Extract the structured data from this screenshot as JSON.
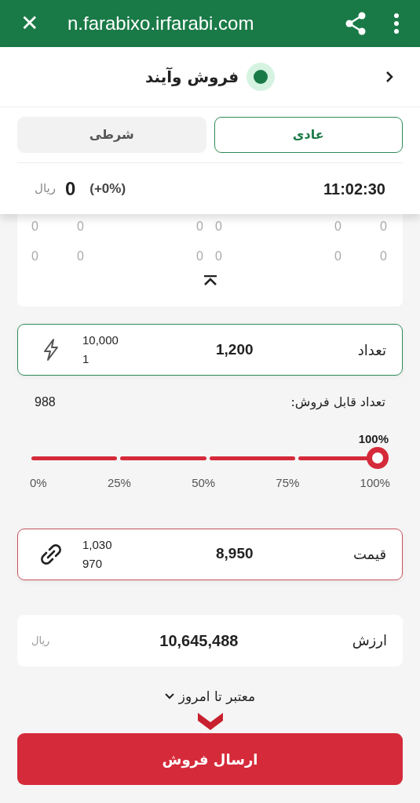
{
  "browser_bar": {
    "close": "✕",
    "url": "n.farabixo.irfarabi.com"
  },
  "header": {
    "title": "فروش وآیند"
  },
  "tabs": [
    {
      "label": "عادی",
      "selected": true
    },
    {
      "label": "شرطی",
      "selected": false
    }
  ],
  "quote": {
    "time": "11:02:30",
    "change": "(+0%)",
    "price": "0",
    "currency": "ریال"
  },
  "order_book": {
    "rows": [
      [
        "0",
        "0",
        "0",
        "0",
        "0",
        "0"
      ],
      [
        "0",
        "0",
        "0",
        "0",
        "0",
        "0"
      ]
    ]
  },
  "fields": [
    {
      "kind": "quantity",
      "label": "تعداد",
      "value": "1,200",
      "max": "10,000",
      "min": "1",
      "color": "#2e8b57"
    },
    {
      "kind": "price",
      "label": "قیمت",
      "value": "8,950",
      "max": "1,030",
      "min": "970",
      "color": "#c8505c"
    }
  ],
  "available": {
    "label": "تعداد قابل فروش:",
    "value": "988"
  },
  "slider": {
    "reading": "100%",
    "level": 1,
    "ticks": [
      "100%",
      "75%",
      "50%",
      "25%",
      "0%"
    ]
  },
  "value_card": {
    "label": "ارزش",
    "value": "10,645,488",
    "currency": "ریال"
  },
  "validity": {
    "label": "معتبر تا امروز"
  },
  "submit": {
    "label": "ارسال فروش"
  }
}
